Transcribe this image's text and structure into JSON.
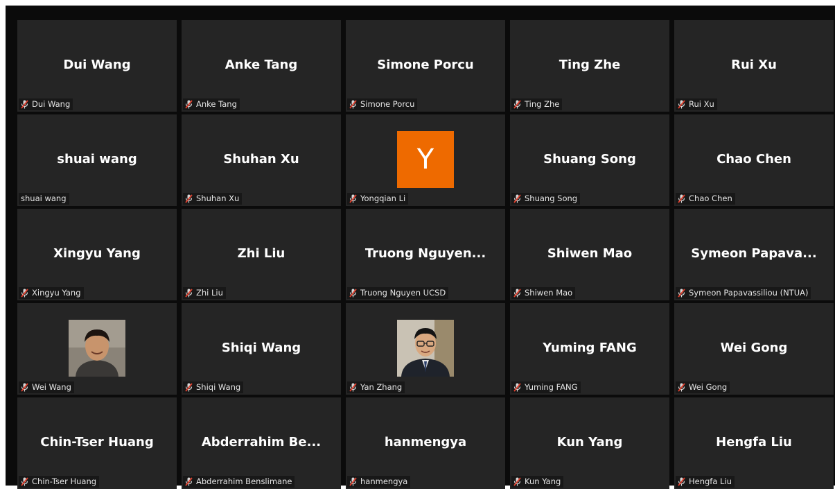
{
  "app": {
    "name": "Video meeting gallery view"
  },
  "colors": {
    "tile_background": "#252525",
    "muted_icon": "#e0402e",
    "avatar_orange": "#ee6a00"
  },
  "participants": [
    {
      "display": "Dui Wang",
      "label": "Dui Wang",
      "muted": true
    },
    {
      "display": "Anke Tang",
      "label": "Anke Tang",
      "muted": true
    },
    {
      "display": "Simone Porcu",
      "label": "Simone Porcu",
      "muted": true
    },
    {
      "display": "Ting Zhe",
      "label": "Ting Zhe",
      "muted": true
    },
    {
      "display": "Rui Xu",
      "label": "Rui Xu",
      "muted": true
    },
    {
      "display": "shuai wang",
      "label": "shuai wang",
      "muted": false
    },
    {
      "display": "Shuhan Xu",
      "label": "Shuhan Xu",
      "muted": true
    },
    {
      "display": "",
      "label": "Yongqian Li",
      "muted": true,
      "avatar_letter": "Y"
    },
    {
      "display": "Shuang Song",
      "label": "Shuang Song",
      "muted": true
    },
    {
      "display": "Chao Chen",
      "label": "Chao Chen",
      "muted": true
    },
    {
      "display": "Xingyu Yang",
      "label": "Xingyu Yang",
      "muted": true
    },
    {
      "display": "Zhi Liu",
      "label": "Zhi Liu",
      "muted": true
    },
    {
      "display": "Truong Nguyen...",
      "label": "Truong Nguyen UCSD",
      "muted": true
    },
    {
      "display": "Shiwen Mao",
      "label": "Shiwen Mao",
      "muted": true
    },
    {
      "display": "Symeon Papava...",
      "label": "Symeon Papavassiliou (NTUA)",
      "muted": true
    },
    {
      "display": "",
      "label": "Wei Wang",
      "muted": true,
      "photo": "profile-photo"
    },
    {
      "display": "Shiqi Wang",
      "label": "Shiqi Wang",
      "muted": true
    },
    {
      "display": "",
      "label": "Yan Zhang",
      "muted": true,
      "photo": "profile-photo"
    },
    {
      "display": "Yuming FANG",
      "label": "Yuming FANG",
      "muted": true
    },
    {
      "display": "Wei Gong",
      "label": "Wei Gong",
      "muted": true
    },
    {
      "display": "Chin-Tser Huang",
      "label": "Chin-Tser Huang",
      "muted": true
    },
    {
      "display": "Abderrahim Be...",
      "label": "Abderrahim Benslimane",
      "muted": true
    },
    {
      "display": "hanmengya",
      "label": "hanmengya",
      "muted": true
    },
    {
      "display": "Kun Yang",
      "label": "Kun Yang",
      "muted": true
    },
    {
      "display": "Hengfa Liu",
      "label": "Hengfa Liu",
      "muted": true
    }
  ]
}
